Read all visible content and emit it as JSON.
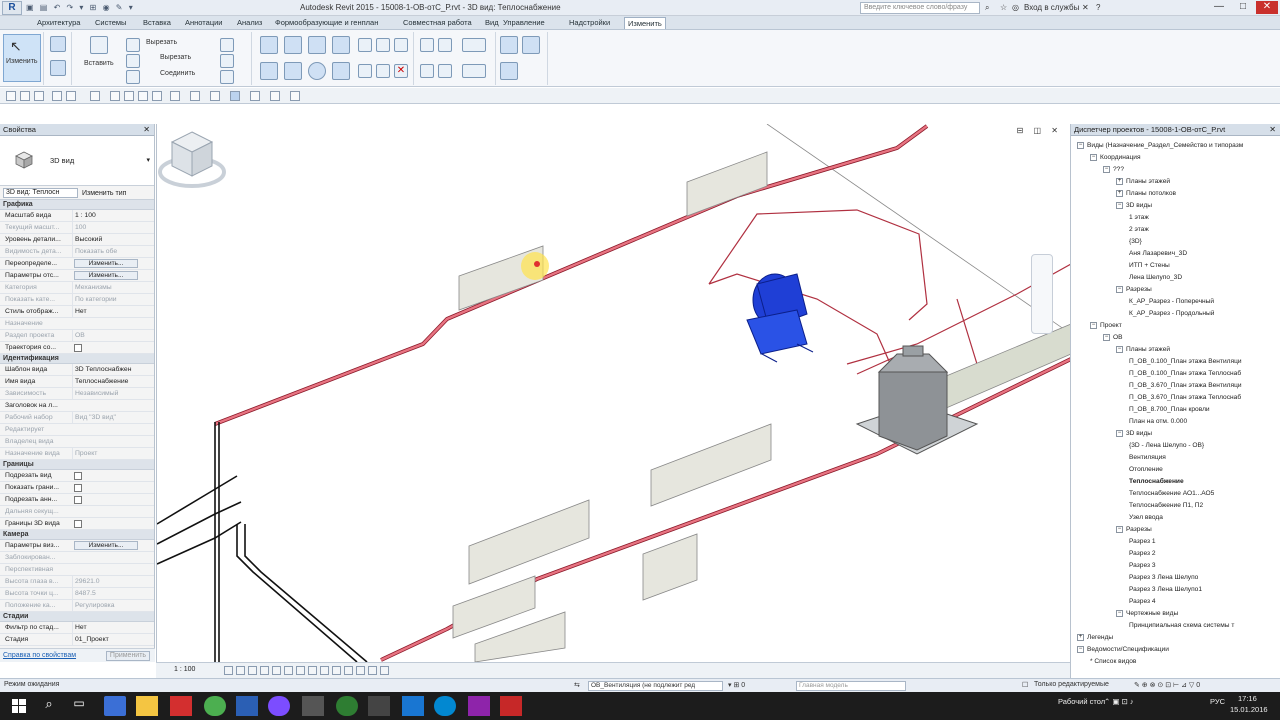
{
  "titlebar": {
    "app_button": "R",
    "title": "Autodesk Revit 2015 -     15008-1-ОВ-отС_Р.rvt - 3D вид: Теплоснабжение",
    "search_placeholder": "Введите ключевое слово/фразу",
    "signin": "Вход в службы",
    "minimize": "—",
    "maximize": "□",
    "close": "✕"
  },
  "ribbon_tabs": [
    "Архитектура",
    "Системы",
    "Вставка",
    "Аннотации",
    "Анализ",
    "Формообразующие и генплан",
    "Совместная работа",
    "Вид",
    "Управление",
    "Надстройки",
    "Изменить"
  ],
  "ribbon": {
    "modify_label": "Изменить",
    "paste_label": "Вставить",
    "cut_label": "Вырезать",
    "copy_label": "Вырезать",
    "join_label": "Соединить",
    "clipboard_label": "Вставить"
  },
  "properties": {
    "title": "Свойства",
    "type_name": "3D вид",
    "instance_selector": "3D вид: Теплосн",
    "edit_type": "Изменить тип",
    "groups": [
      {
        "name": "Графика",
        "rows": [
          {
            "k": "Масштаб вида",
            "v": "1 : 100",
            "dim": false
          },
          {
            "k": "Текущий масшт...",
            "v": "100",
            "dim": true
          },
          {
            "k": "Уровень детали...",
            "v": "Высокий",
            "dim": false
          },
          {
            "k": "Видимость дета...",
            "v": "Показать обе",
            "dim": true
          },
          {
            "k": "Переопределе...",
            "v": "Изменить...",
            "btn": true
          },
          {
            "k": "Параметры отс...",
            "v": "Изменить...",
            "btn": true
          },
          {
            "k": "Категория",
            "v": "Механизмы",
            "dim": true
          },
          {
            "k": "Показать кате...",
            "v": "По категории",
            "dim": true
          },
          {
            "k": "Стиль отображ...",
            "v": "Нет",
            "dim": false
          },
          {
            "k": "Назначение",
            "v": "",
            "dim": true
          },
          {
            "k": "Раздел проекта",
            "v": "ОВ",
            "dim": true
          },
          {
            "k": "Траектория со...",
            "v": "",
            "chk": true
          }
        ]
      },
      {
        "name": "Идентификация",
        "rows": [
          {
            "k": "Шаблон вида",
            "v": "3D Теплоснабжен",
            "dim": false
          },
          {
            "k": "Имя вида",
            "v": "Теплоснабжение",
            "dim": false
          },
          {
            "k": "Зависимость",
            "v": "Независимый",
            "dim": true
          },
          {
            "k": "Заголовок на л...",
            "v": "",
            "dim": false
          },
          {
            "k": "Рабочий набор",
            "v": "Вид \"3D вид\"",
            "dim": true
          },
          {
            "k": "Редактирует",
            "v": "",
            "dim": true
          },
          {
            "k": "Владелец вида",
            "v": "",
            "dim": true
          },
          {
            "k": "Назначение вида",
            "v": "Проект",
            "dim": true
          }
        ]
      },
      {
        "name": "Границы",
        "rows": [
          {
            "k": "Подрезать вид",
            "v": "",
            "chk": true
          },
          {
            "k": "Показать грани...",
            "v": "",
            "chk": true
          },
          {
            "k": "Подрезать анн...",
            "v": "",
            "chk": true
          },
          {
            "k": "Дальняя секущ...",
            "v": "",
            "dim": true
          },
          {
            "k": "Границы 3D вида",
            "v": "",
            "chk": true
          }
        ]
      },
      {
        "name": "Камера",
        "rows": [
          {
            "k": "Параметры виз...",
            "v": "Изменить...",
            "btn": true
          },
          {
            "k": "Заблокирован...",
            "v": "",
            "dim": true
          },
          {
            "k": "Перспективная",
            "v": "",
            "dim": true
          },
          {
            "k": "Высота глаза в...",
            "v": "29621.0",
            "dim": true
          },
          {
            "k": "Высота точки ц...",
            "v": "8487.5",
            "dim": true
          },
          {
            "k": "Положение ка...",
            "v": "Регулировка",
            "dim": true
          }
        ]
      },
      {
        "name": "Стадии",
        "rows": [
          {
            "k": "Фильтр по стад...",
            "v": "Нет",
            "dim": false
          },
          {
            "k": "Стадия",
            "v": "01_Проект",
            "dim": false
          }
        ]
      }
    ],
    "help_link": "Справка по свойствам",
    "apply": "Применить"
  },
  "view": {
    "scale": "1 : 100",
    "viewcube_label": "СЕВЕР"
  },
  "browser": {
    "title": "Диспетчер проектов - 15008-1-ОВ-отС_Р.rvt",
    "nodes": [
      {
        "t": "Виды (Назначение_Раздел_Семейство и типоразм",
        "lvl": 0,
        "tog": "−"
      },
      {
        "t": "Координация",
        "lvl": 1,
        "tog": "−"
      },
      {
        "t": "???",
        "lvl": 2,
        "tog": "−"
      },
      {
        "t": "Планы этажей",
        "lvl": 3,
        "tog": "+"
      },
      {
        "t": "Планы потолков",
        "lvl": 3,
        "tog": "+"
      },
      {
        "t": "3D виды",
        "lvl": 3,
        "tog": "−"
      },
      {
        "t": "1 этаж",
        "lvl": 4
      },
      {
        "t": "2 этаж",
        "lvl": 4
      },
      {
        "t": "{3D}",
        "lvl": 4
      },
      {
        "t": "Аня Лазаревич_3D",
        "lvl": 4
      },
      {
        "t": "ИТП + Стены",
        "lvl": 4
      },
      {
        "t": "Лена Шелупо_3D",
        "lvl": 4
      },
      {
        "t": "Разрезы",
        "lvl": 3,
        "tog": "−"
      },
      {
        "t": "К_АР_Разрез - Поперечный",
        "lvl": 4
      },
      {
        "t": "К_АР_Разрез - Продольный",
        "lvl": 4
      },
      {
        "t": "Проект",
        "lvl": 1,
        "tog": "−"
      },
      {
        "t": "ОВ",
        "lvl": 2,
        "tog": "−"
      },
      {
        "t": "Планы этажей",
        "lvl": 3,
        "tog": "−"
      },
      {
        "t": "П_ОВ_0.100_План этажа Вентиляци",
        "lvl": 4
      },
      {
        "t": "П_ОВ_0.100_План этажа Теплоснаб",
        "lvl": 4
      },
      {
        "t": "П_ОВ_3.670_План этажа Вентиляци",
        "lvl": 4
      },
      {
        "t": "П_ОВ_3.670_План этажа Теплоснаб",
        "lvl": 4
      },
      {
        "t": "П_ОВ_8.700_План кровли",
        "lvl": 4
      },
      {
        "t": "План на отм. 0.000",
        "lvl": 4
      },
      {
        "t": "3D виды",
        "lvl": 3,
        "tog": "−"
      },
      {
        "t": "{3D - Лена Шелупо - ОВ}",
        "lvl": 4
      },
      {
        "t": "Вентиляция",
        "lvl": 4
      },
      {
        "t": "Отопление",
        "lvl": 4
      },
      {
        "t": "Теплоснабжение",
        "lvl": 4,
        "bold": true
      },
      {
        "t": "Теплоснабжение АО1...АО5",
        "lvl": 4
      },
      {
        "t": "Теплоснабжение П1, П2",
        "lvl": 4
      },
      {
        "t": "Узел ввода",
        "lvl": 4
      },
      {
        "t": "Разрезы",
        "lvl": 3,
        "tog": "−"
      },
      {
        "t": "Разрез 1",
        "lvl": 4
      },
      {
        "t": "Разрез 2",
        "lvl": 4
      },
      {
        "t": "Разрез 3",
        "lvl": 4
      },
      {
        "t": "Разрез 3 Лена Шелупо",
        "lvl": 4
      },
      {
        "t": "Разрез 3 Лена Шелупо1",
        "lvl": 4
      },
      {
        "t": "Разрез 4",
        "lvl": 4
      },
      {
        "t": "Чертежные виды",
        "lvl": 3,
        "tog": "−"
      },
      {
        "t": "Принципиальная схема системы т",
        "lvl": 4
      },
      {
        "t": "Легенды",
        "lvl": 0,
        "tog": "+"
      },
      {
        "t": "Ведомости/Спецификации",
        "lvl": 0,
        "tog": "−"
      },
      {
        "t": "* Список видов",
        "lvl": 1
      }
    ]
  },
  "statusbar": {
    "left": "Режим ожидания",
    "workset": "ОВ_Вентиляция (не подлежит ред",
    "design_option": "Главная модель",
    "editable_only": "Только редактируемые"
  },
  "taskbar": {
    "desktop": "Рабочий стол",
    "lang": "РУС",
    "time": "17:16",
    "date": "15.01.2016"
  },
  "colors": {
    "pipe": "#e06070",
    "pipe_outline": "#8b1a2a",
    "radiator": "#e6e6de",
    "fan": "#1f3fd6"
  }
}
